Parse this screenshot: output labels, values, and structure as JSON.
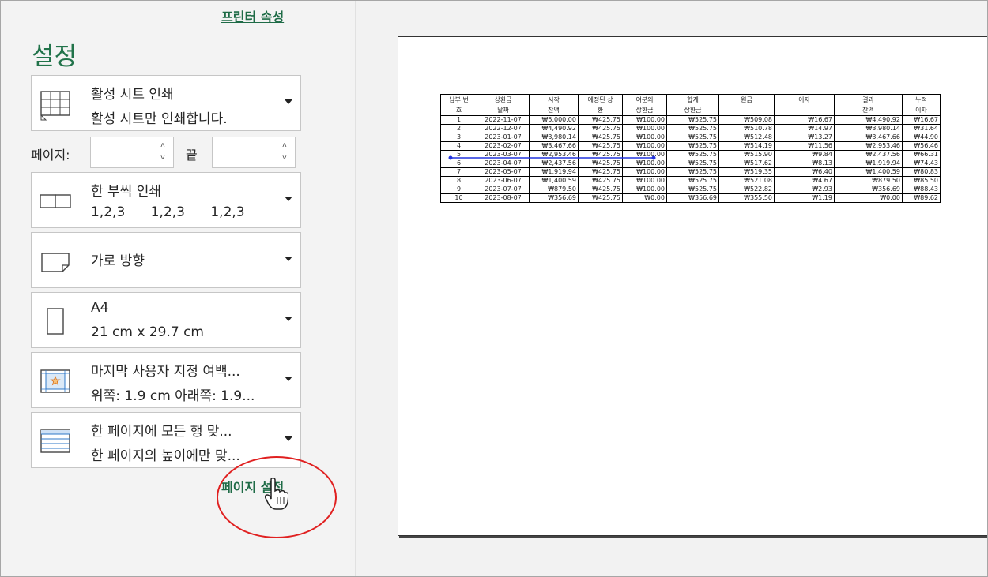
{
  "printer_properties_link": "프린터 속성",
  "settings_title": "설정",
  "dropdowns": [
    {
      "title": "활성 시트 인쇄",
      "subtitle": "활성 시트만 인쇄합니다.",
      "icon": "print-sheet-icon"
    },
    {
      "title": "한 부씩 인쇄",
      "subtitle": "1,2,3      1,2,3      1,2,3",
      "icon": "collate-icon"
    },
    {
      "title": "가로 방향",
      "subtitle": "",
      "icon": "landscape-icon"
    },
    {
      "title": "A4",
      "subtitle": "21 cm x 29.7 cm",
      "icon": "paper-size-icon"
    },
    {
      "title": "마지막 사용자 지정 여백...",
      "subtitle": "위쪽: 1.9 cm 아래쪽: 1.9...",
      "icon": "margins-icon"
    },
    {
      "title": "한 페이지에 모든 행 맞...",
      "subtitle": "한 페이지의 높이에만 맞...",
      "icon": "fit-rows-icon"
    }
  ],
  "pages": {
    "label": "페이지:",
    "from_value": "",
    "end_label": "끝",
    "to_value": ""
  },
  "page_setup_link": "페이지 설정",
  "preview": {
    "headers": [
      [
        "납부 번",
        "호"
      ],
      [
        "상환금",
        "날짜"
      ],
      [
        "시작",
        "잔액"
      ],
      [
        "예정된 상",
        "환"
      ],
      [
        "여분의",
        "상환금"
      ],
      [
        "합계",
        "상환금"
      ],
      [
        "원금",
        ""
      ],
      [
        "이자",
        ""
      ],
      [
        "결과",
        "잔액"
      ],
      [
        "누적",
        "이자"
      ]
    ],
    "rows": [
      [
        "1",
        "2022-11-07",
        "₩5,000.00",
        "₩425.75",
        "₩100.00",
        "₩525.75",
        "₩509.08",
        "₩16.67",
        "₩4,490.92",
        "₩16.67"
      ],
      [
        "2",
        "2022-12-07",
        "₩4,490.92",
        "₩425.75",
        "₩100.00",
        "₩525.75",
        "₩510.78",
        "₩14.97",
        "₩3,980.14",
        "₩31.64"
      ],
      [
        "3",
        "2023-01-07",
        "₩3,980.14",
        "₩425.75",
        "₩100.00",
        "₩525.75",
        "₩512.48",
        "₩13.27",
        "₩3,467.66",
        "₩44.90"
      ],
      [
        "4",
        "2023-02-07",
        "₩3,467.66",
        "₩425.75",
        "₩100.00",
        "₩525.75",
        "₩514.19",
        "₩11.56",
        "₩2,953.46",
        "₩56.46"
      ],
      [
        "5",
        "2023-03-07",
        "₩2,953.46",
        "₩425.75",
        "₩100.00",
        "₩525.75",
        "₩515.90",
        "₩9.84",
        "₩2,437.56",
        "₩66.31"
      ],
      [
        "6",
        "2023-04-07",
        "₩2,437.56",
        "₩425.75",
        "₩100.00",
        "₩525.75",
        "₩517.62",
        "₩8.13",
        "₩1,919.94",
        "₩74.43"
      ],
      [
        "7",
        "2023-05-07",
        "₩1,919.94",
        "₩425.75",
        "₩100.00",
        "₩525.75",
        "₩519.35",
        "₩6.40",
        "₩1,400.59",
        "₩80.83"
      ],
      [
        "8",
        "2023-06-07",
        "₩1,400.59",
        "₩425.75",
        "₩100.00",
        "₩525.75",
        "₩521.08",
        "₩4.67",
        "₩879.50",
        "₩85.50"
      ],
      [
        "9",
        "2023-07-07",
        "₩879.50",
        "₩425.75",
        "₩100.00",
        "₩525.75",
        "₩522.82",
        "₩2.93",
        "₩356.69",
        "₩88.43"
      ],
      [
        "10",
        "2023-08-07",
        "₩356.69",
        "₩425.75",
        "₩0.00",
        "₩356.69",
        "₩355.50",
        "₩1.19",
        "₩0.00",
        "₩89.62"
      ]
    ]
  },
  "colors": {
    "accent": "#21734a",
    "highlight_circle": "#e02020",
    "marker_line": "#2233dd"
  }
}
